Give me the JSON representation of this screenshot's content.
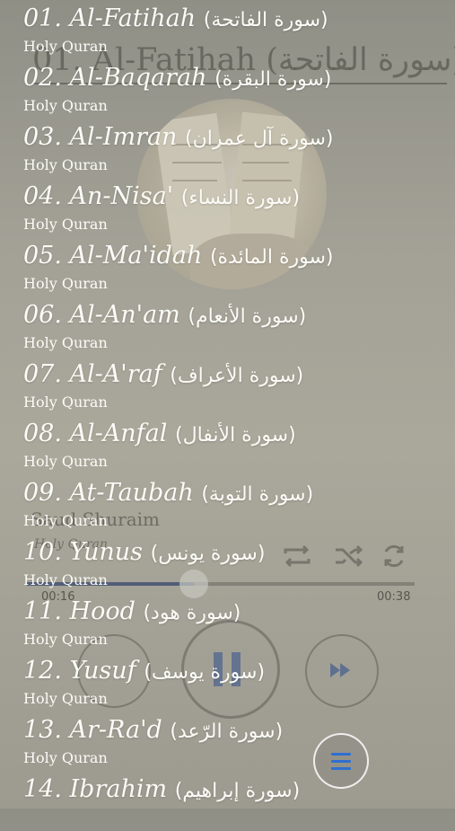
{
  "player": {
    "title": "01. Al-Fatihah (سورة الفاتحة)",
    "reciter": "Saud Shuraim",
    "subtitle": "Holy Quran",
    "elapsed": "00:16",
    "duration": "00:38",
    "progress": 0.43,
    "icons": [
      "repeat-icon",
      "shuffle-icon",
      "repeat-one-icon",
      "previous-icon",
      "pause-icon",
      "next-icon",
      "menu-icon"
    ],
    "accent": "#2f6fd0"
  },
  "surahs": [
    {
      "name": "01. Al-Fatihah ",
      "arabic": "(سورة الفاتحة)",
      "sub": "Holy Quran"
    },
    {
      "name": "02. Al-Baqarah ",
      "arabic": "(سورة البقرة)",
      "sub": "Holy Quran"
    },
    {
      "name": "03. Al-Imran ",
      "arabic": "(سورة آل عمران)",
      "sub": "Holy Quran"
    },
    {
      "name": "04. An-Nisa' ",
      "arabic": "(سورة النساء)",
      "sub": "Holy Quran"
    },
    {
      "name": "05. Al-Ma'idah ",
      "arabic": "(سورة المائدة)",
      "sub": "Holy Quran"
    },
    {
      "name": "06. Al-An'am ",
      "arabic": "(سورة الأنعام)",
      "sub": "Holy Quran"
    },
    {
      "name": "07. Al-A'raf ",
      "arabic": "(سورة الأعراف)",
      "sub": "Holy Quran"
    },
    {
      "name": "08. Al-Anfal ",
      "arabic": "(سورة الأنفال)",
      "sub": "Holy Quran"
    },
    {
      "name": "09. At-Taubah ",
      "arabic": "(سورة التوبة)",
      "sub": "Holy Quran"
    },
    {
      "name": "10. Yunus ",
      "arabic": "(سورة يونس)",
      "sub": "Holy Quran"
    },
    {
      "name": "11. Hood ",
      "arabic": "(سورة هود)",
      "sub": "Holy Quran"
    },
    {
      "name": "12. Yusuf ",
      "arabic": "(سورة يوسف)",
      "sub": "Holy Quran"
    },
    {
      "name": "13. Ar-Ra'd ",
      "arabic": "(سورة الرّعد)",
      "sub": "Holy Quran"
    },
    {
      "name": "14. Ibrahim ",
      "arabic": "(سورة إبراهيم)",
      "sub": ""
    }
  ]
}
